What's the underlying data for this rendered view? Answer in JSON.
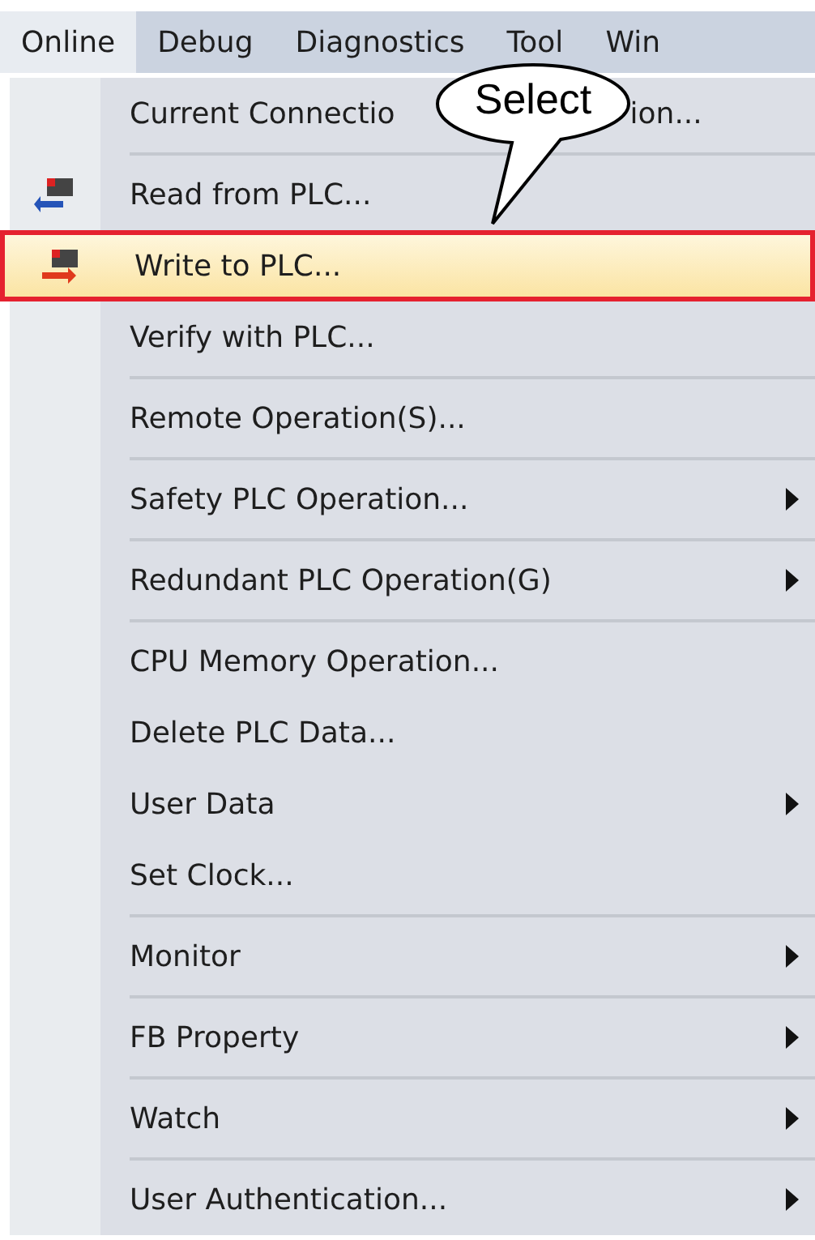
{
  "menu_bar": [
    {
      "label": "Online",
      "selected": true
    },
    {
      "label": "Debug",
      "selected": false
    },
    {
      "label": "Diagnostics",
      "selected": false
    },
    {
      "label": "Tool",
      "selected": false
    },
    {
      "label": "Win",
      "selected": false
    }
  ],
  "menu": {
    "items": [
      {
        "label": "Current Connectio",
        "label_end": "ion...",
        "kind": "plain",
        "submenu": false,
        "separator_after": true,
        "selected": false
      },
      {
        "label": "Read from PLC...",
        "kind": "read",
        "submenu": false,
        "separator_after": false,
        "selected": false
      },
      {
        "label": "Write to PLC...",
        "kind": "write",
        "submenu": false,
        "separator_after": false,
        "selected": true
      },
      {
        "label": "Verify with PLC...",
        "kind": "plain",
        "submenu": false,
        "separator_after": true,
        "selected": false
      },
      {
        "label": "Remote Operation(S)...",
        "kind": "plain",
        "submenu": false,
        "separator_after": true,
        "selected": false
      },
      {
        "label": "Safety PLC Operation...",
        "kind": "plain",
        "submenu": true,
        "separator_after": true,
        "selected": false
      },
      {
        "label": "Redundant PLC Operation(G)",
        "kind": "plain",
        "submenu": true,
        "separator_after": true,
        "selected": false
      },
      {
        "label": "CPU Memory Operation...",
        "kind": "plain",
        "submenu": false,
        "separator_after": false,
        "selected": false
      },
      {
        "label": "Delete PLC Data...",
        "kind": "plain",
        "submenu": false,
        "separator_after": false,
        "selected": false
      },
      {
        "label": "User Data",
        "kind": "plain",
        "submenu": true,
        "separator_after": false,
        "selected": false
      },
      {
        "label": "Set Clock...",
        "kind": "plain",
        "submenu": false,
        "separator_after": true,
        "selected": false
      },
      {
        "label": "Monitor",
        "kind": "plain",
        "submenu": true,
        "separator_after": true,
        "selected": false
      },
      {
        "label": "FB Property",
        "kind": "plain",
        "submenu": true,
        "separator_after": true,
        "selected": false
      },
      {
        "label": "Watch",
        "kind": "plain",
        "submenu": true,
        "separator_after": true,
        "selected": false
      },
      {
        "label": "User Authentication...",
        "kind": "plain",
        "submenu": true,
        "separator_after": false,
        "selected": false
      }
    ]
  },
  "callout": {
    "text": "Select"
  }
}
